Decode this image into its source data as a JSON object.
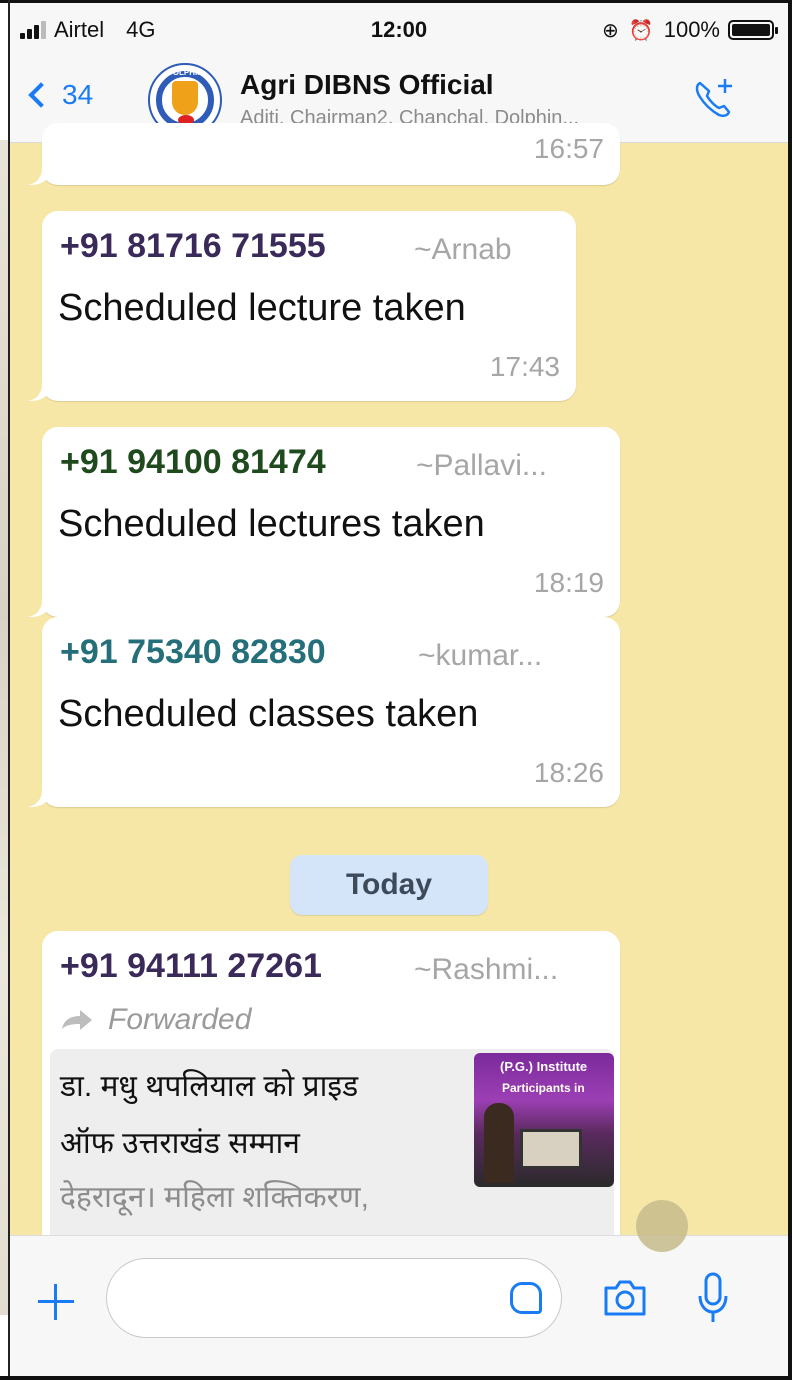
{
  "status": {
    "carrier": "Airtel",
    "network": "4G",
    "time": "12:00",
    "battery": "100%"
  },
  "header": {
    "back_count": "34",
    "title": "Agri DIBNS Official",
    "subtitle": "Aditi, Chairman2, Chanchal, Dolphin...",
    "avatar_text": "DOLPHIN"
  },
  "messages": [
    {
      "time": "16:57"
    },
    {
      "sender": "+91 81716 71555",
      "alias": "~Arnab",
      "text": "Scheduled lecture taken",
      "time": "17:43",
      "color": "#3a2a5a"
    },
    {
      "sender": "+91 94100 81474",
      "alias": "~Pallavi...",
      "text": "Scheduled lectures taken",
      "time": "18:19",
      "color": "#1e4a1e"
    },
    {
      "sender": "+91 75340 82830",
      "alias": "~kumar...",
      "text": "Scheduled classes taken",
      "time": "18:26",
      "color": "#256f7a"
    }
  ],
  "divider": "Today",
  "forwarded_message": {
    "sender": "+91 94111 27261",
    "alias": "~Rashmi...",
    "forwarded_label": "Forwarded",
    "preview_line1": "डा. मधु थपलियाल को प्राइड",
    "preview_line2": "ऑफ उत्तराखंड सम्मान",
    "preview_line3": "देहरादून। महिला शक्तिकरण,",
    "thumb_line1": "(P.G.) Institute",
    "thumb_line2": "Participants in",
    "sender_color": "#3a2a5a"
  },
  "input": {
    "placeholder": ""
  },
  "icons": {
    "back": "chevron-left-icon",
    "call": "add-call-icon",
    "plus": "plus-icon",
    "sticker": "sticker-icon",
    "camera": "camera-icon",
    "mic": "microphone-icon",
    "forward": "forward-arrow-icon"
  },
  "colors": {
    "accent": "#1a7cf5",
    "chat_background": "#f6e7a6",
    "date_chip": "#d4e5fa"
  }
}
